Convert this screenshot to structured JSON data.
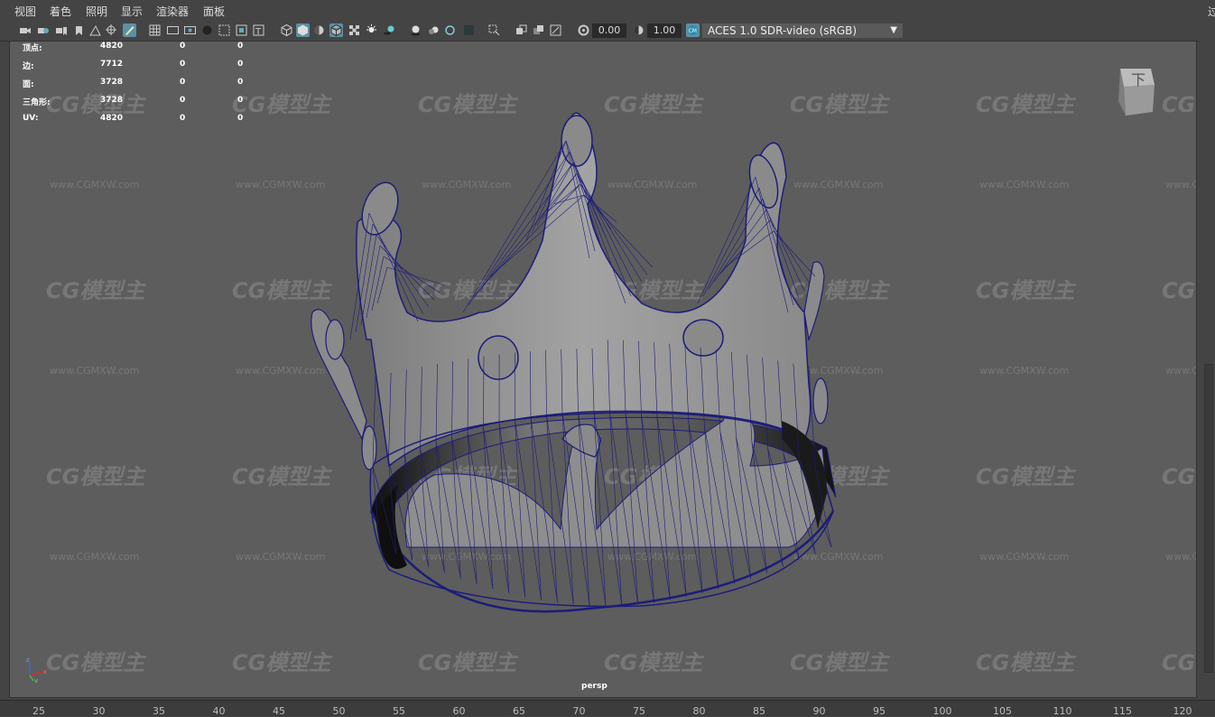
{
  "menu": {
    "items": [
      "视图",
      "着色",
      "照明",
      "显示",
      "渲染器",
      "面板"
    ],
    "right_edge_text": "过"
  },
  "toolbar": {
    "exposure_value": "0.00",
    "gamma_value": "1.00",
    "color_space": "ACES 1.0 SDR-video (sRGB)"
  },
  "hud": {
    "rows": [
      {
        "label": "顶点:",
        "v1": "4820",
        "v2": "0",
        "v3": "0"
      },
      {
        "label": "边:",
        "v1": "7712",
        "v2": "0",
        "v3": "0"
      },
      {
        "label": "面:",
        "v1": "3728",
        "v2": "0",
        "v3": "0"
      },
      {
        "label": "三角形:",
        "v1": "3728",
        "v2": "0",
        "v3": "0"
      },
      {
        "label": "UV:",
        "v1": "4820",
        "v2": "0",
        "v3": "0"
      }
    ]
  },
  "viewport": {
    "camera_label": "persp",
    "viewcube_label": "下",
    "axis": {
      "z": "z",
      "x": "x",
      "y": "y"
    },
    "watermark_logo": "CG模型主",
    "watermark_url": "www.CGMXW.com",
    "wire_color": "#1c1c7a"
  },
  "timeline": {
    "ticks": [
      "25",
      "30",
      "35",
      "40",
      "45",
      "50",
      "55",
      "60",
      "65",
      "70",
      "75",
      "80",
      "85",
      "90",
      "95",
      "100",
      "105",
      "110",
      "115",
      "120"
    ]
  }
}
